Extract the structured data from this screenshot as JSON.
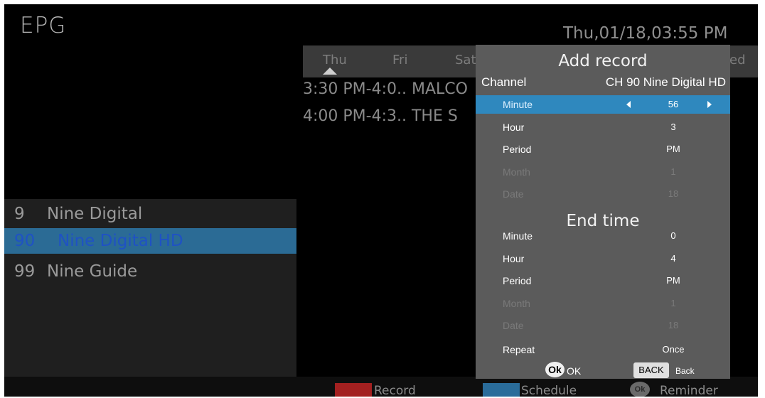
{
  "app": {
    "title": "EPG",
    "datetime": "Thu,01/18,03:55 PM"
  },
  "days": [
    "Thu",
    "Fri",
    "Sat",
    "ed"
  ],
  "programs": [
    {
      "time": "3:30 PM-4:0..",
      "name": "MALCO"
    },
    {
      "time": "4:00 PM-4:3..",
      "name": "THE S"
    }
  ],
  "channels": [
    {
      "num": "9",
      "name": "Nine Digital",
      "selected": false
    },
    {
      "num": "90",
      "name": "Nine Digital HD",
      "selected": true
    },
    {
      "num": "99",
      "name": "Nine Guide",
      "selected": false
    }
  ],
  "legend": {
    "record": "Record",
    "record_color": "#a32020",
    "schedule": "Schedule",
    "schedule_color": "#2a6c9a",
    "ok_key": "Ok",
    "reminder": "Reminder"
  },
  "dialog": {
    "title": "Add record",
    "channel_label": "Channel",
    "channel_value": "CH 90  Nine Digital HD",
    "start": [
      {
        "label": "Minute",
        "value": "56",
        "selected": true,
        "dim": false
      },
      {
        "label": "Hour",
        "value": "3",
        "selected": false,
        "dim": false
      },
      {
        "label": "Period",
        "value": "PM",
        "selected": false,
        "dim": false
      },
      {
        "label": "Month",
        "value": "1",
        "selected": false,
        "dim": true
      },
      {
        "label": "Date",
        "value": "18",
        "selected": false,
        "dim": true
      }
    ],
    "end_title": "End time",
    "end": [
      {
        "label": "Minute",
        "value": "0",
        "dim": false
      },
      {
        "label": "Hour",
        "value": "4",
        "dim": false
      },
      {
        "label": "Period",
        "value": "PM",
        "dim": false
      },
      {
        "label": "Month",
        "value": "1",
        "dim": true
      },
      {
        "label": "Date",
        "value": "18",
        "dim": true
      }
    ],
    "repeat": {
      "label": "Repeat",
      "value": "Once"
    },
    "ok_key": "Ok",
    "ok_label": "OK",
    "back_key": "BACK",
    "back_label": "Back",
    "highlight_color": "#2f88be"
  }
}
